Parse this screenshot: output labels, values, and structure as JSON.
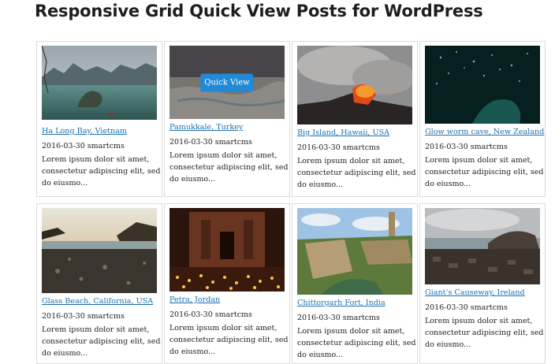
{
  "page": {
    "title": "Responsive Grid Quick View Posts for WordPress"
  },
  "quick_view_label": "Quick View",
  "posts": [
    {
      "title": "Ha Long Bay, Vietnam",
      "meta": "2016-03-30 smartcms",
      "excerpt": "Lorem ipsum dolor sit amet, consectetur adipiscing elit, sed do eiusmo..."
    },
    {
      "title": "Pamukkale, Turkey",
      "meta": "2016-03-30 smartcms",
      "excerpt": "Lorem ipsum dolor sit amet, consectetur adipiscing elit, sed do eiusmo..."
    },
    {
      "title": "Big Island, Hawaii, USA",
      "meta": "2016-03-30 smartcms",
      "excerpt": "Lorem ipsum dolor sit amet, consectetur adipiscing elit, sed do eiusmo..."
    },
    {
      "title": "Glow worm cave, New Zealand",
      "meta": "2016-03-30 smartcms",
      "excerpt": "Lorem ipsum dolor sit amet, consectetur adipiscing elit, sed do eiusmo..."
    },
    {
      "title": "Glass Beach, California, USA",
      "meta": "2016-03-30 smartcms",
      "excerpt": "Lorem ipsum dolor sit amet, consectetur adipiscing elit, sed do eiusmo..."
    },
    {
      "title": "Petra, Jordan",
      "meta": "2016-03-30 smartcms",
      "excerpt": "Lorem ipsum dolor sit amet, consectetur adipiscing elit, sed do eiusmo..."
    },
    {
      "title": "Chittorgarh Fort, India",
      "meta": "2016-03-30 smartcms",
      "excerpt": "Lorem ipsum dolor sit amet, consectetur adipiscing elit, sed do eiusmo..."
    },
    {
      "title": "Giant’s Causeway, Ireland",
      "meta": "2016-03-30 smartcms",
      "excerpt": "Lorem ipsum dolor sit amet, consectetur adipiscing elit, sed do eiusmo..."
    }
  ]
}
